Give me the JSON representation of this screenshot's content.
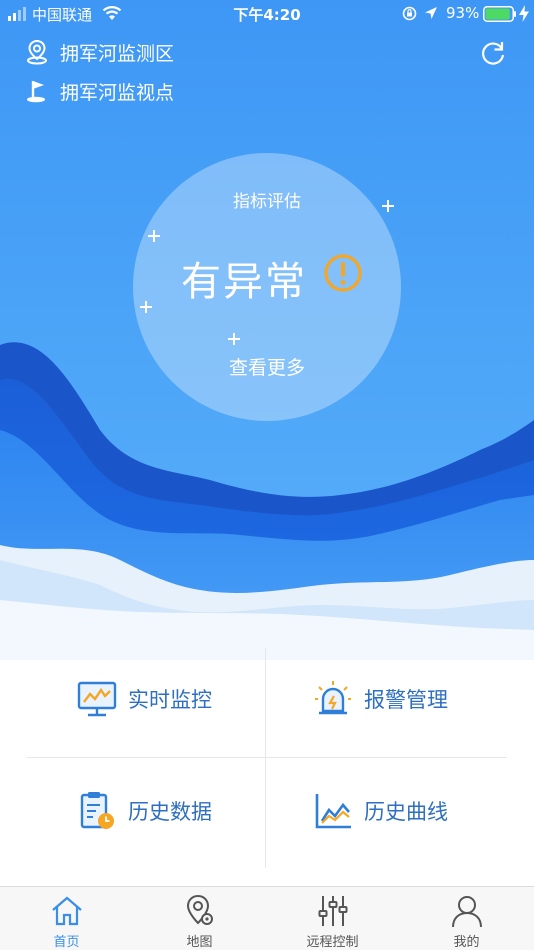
{
  "status_bar": {
    "carrier": "中国联通",
    "time": "下午4:20",
    "battery": "93%",
    "battery_level": 0.93,
    "signal_icon": "signal-bars-icon",
    "wifi_icon": "wifi-icon"
  },
  "header": {
    "area_label": "拥军河监测区",
    "area_icon": "location-pin-icon",
    "point_label": "拥军河监视点",
    "point_icon": "flag-icon",
    "refresh_icon": "refresh-icon"
  },
  "evaluation": {
    "title": "指标评估",
    "status": "有异常",
    "status_icon": "warning-icon",
    "more_label": "查看更多"
  },
  "menu": [
    {
      "label": "实时监控",
      "icon": "monitor-chart-icon"
    },
    {
      "label": "报警管理",
      "icon": "alarm-light-icon"
    },
    {
      "label": "历史数据",
      "icon": "clipboard-clock-icon"
    },
    {
      "label": "历史曲线",
      "icon": "line-chart-icon"
    }
  ],
  "tabs": [
    {
      "label": "首页",
      "icon": "home-icon",
      "active": true
    },
    {
      "label": "地图",
      "icon": "map-pin-icon",
      "active": false
    },
    {
      "label": "远程控制",
      "icon": "sliders-icon",
      "active": false
    },
    {
      "label": "我的",
      "icon": "user-icon",
      "active": false
    }
  ],
  "colors": {
    "accent": "#3a8ee8",
    "hero_blue": "#3e97f5",
    "warning": "#f5a623",
    "menu_text": "#2e6fc0"
  }
}
